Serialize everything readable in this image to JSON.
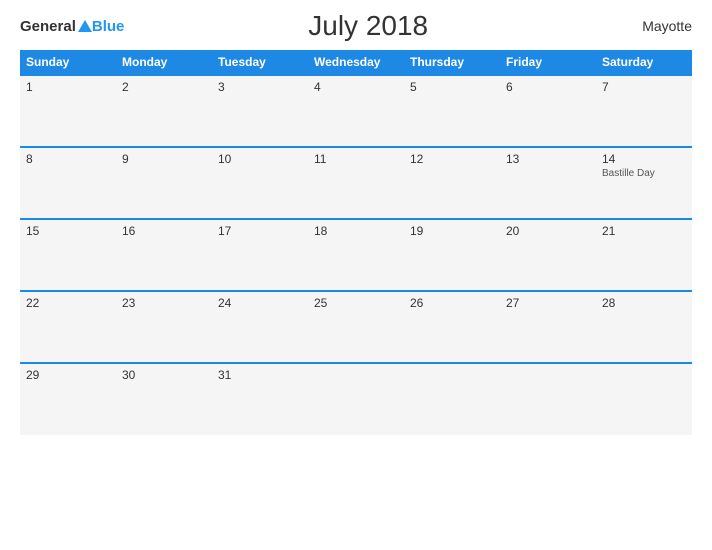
{
  "header": {
    "logo_general": "General",
    "logo_blue": "Blue",
    "title": "July 2018",
    "country": "Mayotte"
  },
  "calendar": {
    "weekdays": [
      "Sunday",
      "Monday",
      "Tuesday",
      "Wednesday",
      "Thursday",
      "Friday",
      "Saturday"
    ],
    "weeks": [
      [
        {
          "day": 1,
          "holiday": ""
        },
        {
          "day": 2,
          "holiday": ""
        },
        {
          "day": 3,
          "holiday": ""
        },
        {
          "day": 4,
          "holiday": ""
        },
        {
          "day": 5,
          "holiday": ""
        },
        {
          "day": 6,
          "holiday": ""
        },
        {
          "day": 7,
          "holiday": ""
        }
      ],
      [
        {
          "day": 8,
          "holiday": ""
        },
        {
          "day": 9,
          "holiday": ""
        },
        {
          "day": 10,
          "holiday": ""
        },
        {
          "day": 11,
          "holiday": ""
        },
        {
          "day": 12,
          "holiday": ""
        },
        {
          "day": 13,
          "holiday": ""
        },
        {
          "day": 14,
          "holiday": "Bastille Day"
        }
      ],
      [
        {
          "day": 15,
          "holiday": ""
        },
        {
          "day": 16,
          "holiday": ""
        },
        {
          "day": 17,
          "holiday": ""
        },
        {
          "day": 18,
          "holiday": ""
        },
        {
          "day": 19,
          "holiday": ""
        },
        {
          "day": 20,
          "holiday": ""
        },
        {
          "day": 21,
          "holiday": ""
        }
      ],
      [
        {
          "day": 22,
          "holiday": ""
        },
        {
          "day": 23,
          "holiday": ""
        },
        {
          "day": 24,
          "holiday": ""
        },
        {
          "day": 25,
          "holiday": ""
        },
        {
          "day": 26,
          "holiday": ""
        },
        {
          "day": 27,
          "holiday": ""
        },
        {
          "day": 28,
          "holiday": ""
        }
      ],
      [
        {
          "day": 29,
          "holiday": ""
        },
        {
          "day": 30,
          "holiday": ""
        },
        {
          "day": 31,
          "holiday": ""
        },
        {
          "day": null,
          "holiday": ""
        },
        {
          "day": null,
          "holiday": ""
        },
        {
          "day": null,
          "holiday": ""
        },
        {
          "day": null,
          "holiday": ""
        }
      ]
    ]
  }
}
